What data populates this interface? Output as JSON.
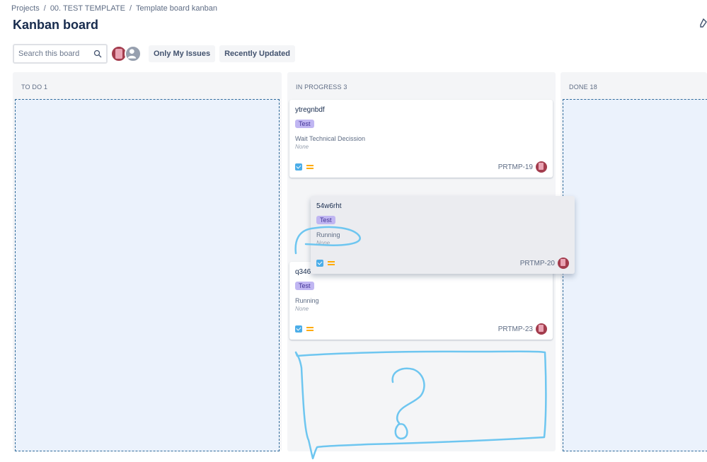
{
  "breadcrumb": {
    "items": [
      "Projects",
      "00. TEST TEMPLATE",
      "Template board kanban"
    ],
    "separator": "/"
  },
  "page_title": "Kanban board",
  "search": {
    "placeholder": "Search this board",
    "value": ""
  },
  "filters": {
    "only_my_issues": "Only My Issues",
    "recently_updated": "Recently Updated"
  },
  "columns": [
    {
      "label": "TO DO 1"
    },
    {
      "label": "IN PROGRESS 3"
    },
    {
      "label": "DONE 18"
    }
  ],
  "cards": [
    {
      "title": "ytregnbdf",
      "tag": "Test",
      "field_label": "Wait Technical Decission",
      "field_value": "None",
      "key": "PRTMP-19"
    },
    {
      "title": "54w6rht",
      "tag": "Test",
      "field_label": "Running",
      "field_value": "None",
      "key": "PRTMP-20"
    },
    {
      "title": "q346",
      "tag": "Test",
      "field_label": "Running",
      "field_value": "None",
      "key": "PRTMP-23"
    }
  ],
  "annotation": {
    "question_mark": "?"
  },
  "colors": {
    "accent": "#4bade8",
    "tag_bg": "#c0b6f2",
    "priority": "#ffab00",
    "dropzone_border": "#2f6a9a",
    "scribble": "#6ec6f0"
  }
}
